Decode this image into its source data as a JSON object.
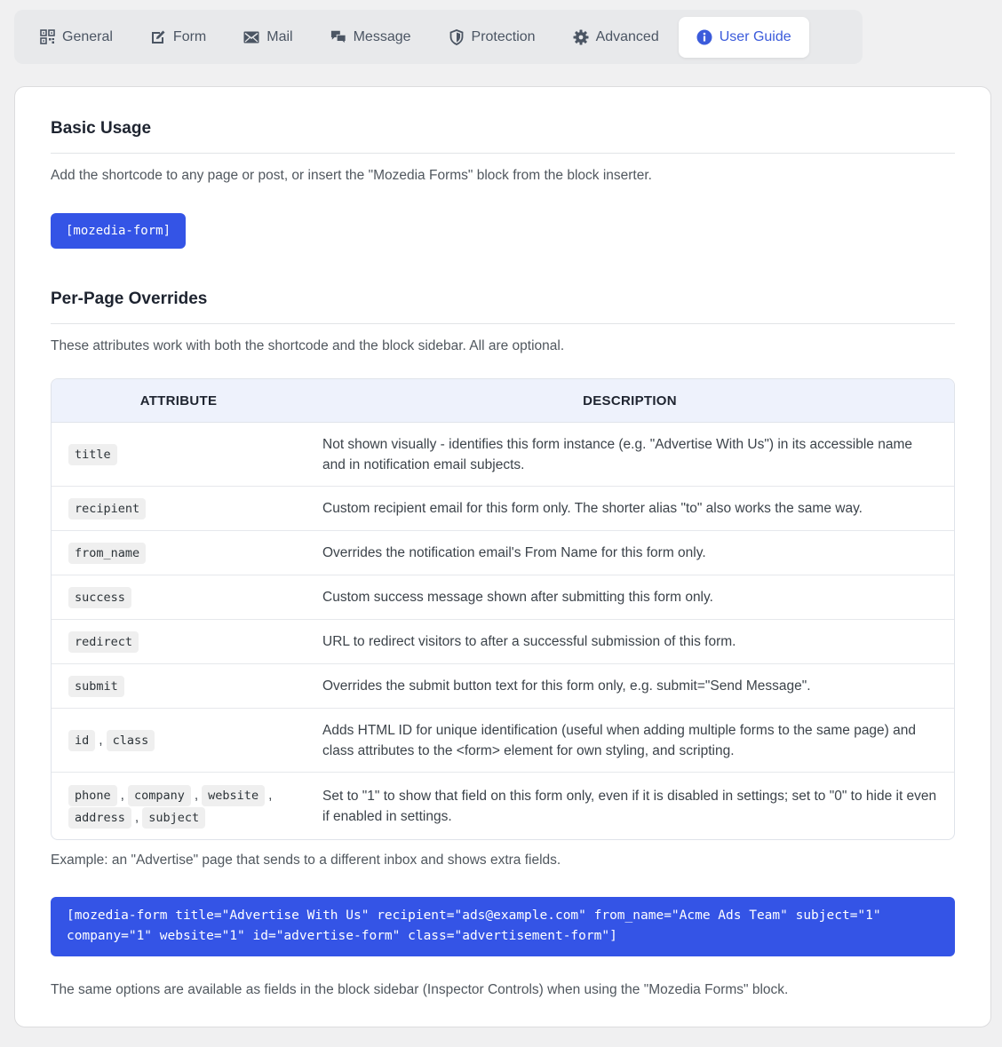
{
  "tabs": [
    {
      "label": "General",
      "icon": "qr-grid-icon"
    },
    {
      "label": "Form",
      "icon": "edit-form-icon"
    },
    {
      "label": "Mail",
      "icon": "envelope-icon"
    },
    {
      "label": "Message",
      "icon": "chat-bubbles-icon"
    },
    {
      "label": "Protection",
      "icon": "shield-icon"
    },
    {
      "label": "Advanced",
      "icon": "gear-icon"
    },
    {
      "label": "User Guide",
      "icon": "info-circle-icon"
    }
  ],
  "active_tab": "User Guide",
  "colors": {
    "accent": "#3454e6",
    "tab_active_text": "#3b5bdb",
    "table_header_bg": "#eef2fc"
  },
  "basic": {
    "title": "Basic Usage",
    "text": "Add the shortcode to any page or post, or insert the \"Mozedia Forms\" block from the block inserter.",
    "shortcode": "[mozedia-form]"
  },
  "overrides": {
    "title": "Per-Page Overrides",
    "text": "These attributes work with both the shortcode and the block sidebar. All are optional.",
    "table": {
      "headers": {
        "attribute": "ATTRIBUTE",
        "description": "DESCRIPTION"
      },
      "rows": [
        {
          "attrs": [
            "title"
          ],
          "desc": "Not shown visually - identifies this form instance (e.g. \"Advertise With Us\") in its accessible name and in notification email subjects."
        },
        {
          "attrs": [
            "recipient"
          ],
          "desc": "Custom recipient email for this form only. The shorter alias \"to\" also works the same way."
        },
        {
          "attrs": [
            "from_name"
          ],
          "desc": "Overrides the notification email's From Name for this form only."
        },
        {
          "attrs": [
            "success"
          ],
          "desc": "Custom success message shown after submitting this form only."
        },
        {
          "attrs": [
            "redirect"
          ],
          "desc": "URL to redirect visitors to after a successful submission of this form."
        },
        {
          "attrs": [
            "submit"
          ],
          "desc": "Overrides the submit button text for this form only, e.g. submit=\"Send Message\"."
        },
        {
          "attrs": [
            "id",
            "class"
          ],
          "desc": "Adds HTML ID for unique identification (useful when adding multiple forms to the same page) and class attributes to the <form> element for own styling, and scripting."
        },
        {
          "attrs": [
            "phone",
            "company",
            "website",
            "address",
            "subject"
          ],
          "desc": "Set to \"1\" to show that field on this form only, even if it is disabled in settings; set to \"0\" to hide it even if enabled in settings."
        }
      ]
    },
    "example_note": "Example: an \"Advertise\" page that sends to a different inbox and shows extra fields.",
    "example_code": "[mozedia-form title=\"Advertise With Us\" recipient=\"ads@example.com\" from_name=\"Acme Ads Team\" subject=\"1\" company=\"1\" website=\"1\" id=\"advertise-form\" class=\"advertisement-form\"]",
    "footer_note": "The same options are available as fields in the block sidebar (Inspector Controls) when using the \"Mozedia Forms\" block."
  }
}
